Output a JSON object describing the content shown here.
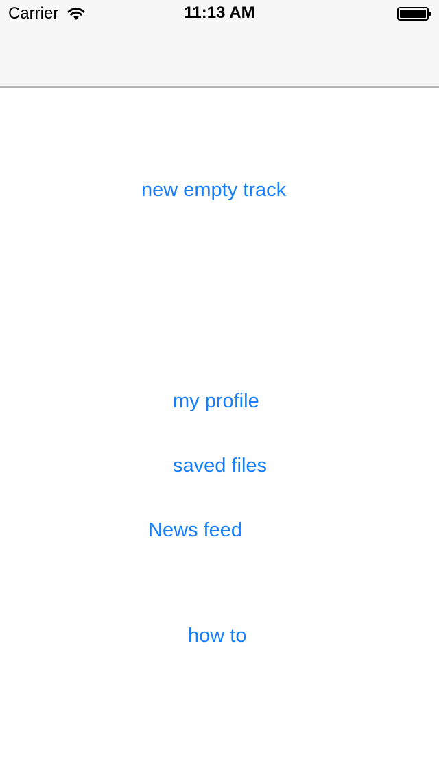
{
  "status_bar": {
    "carrier": "Carrier",
    "time": "11:13 AM",
    "wifi_icon": "wifi-icon",
    "battery_icon": "battery-icon"
  },
  "menu": {
    "new_empty_track": "new empty track",
    "my_profile": "my profile",
    "saved_files": "saved files",
    "news_feed": "News feed",
    "how_to": "how to"
  },
  "colors": {
    "link": "#157efb",
    "navbar_bg": "#f7f7f7",
    "navbar_border": "#b2b2b2",
    "background": "#ffffff"
  }
}
